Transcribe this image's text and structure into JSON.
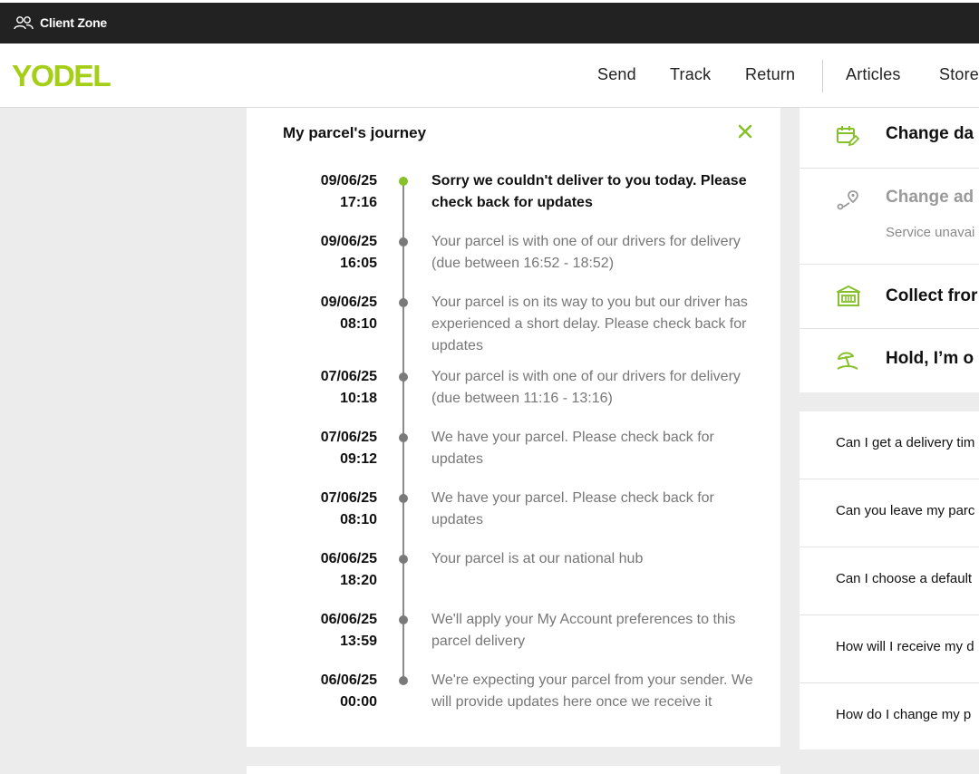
{
  "topbar": {
    "client_zone": "Client Zone"
  },
  "header": {
    "logo": "YODEL",
    "nav": [
      "Send",
      "Track",
      "Return",
      "Articles",
      "Store"
    ]
  },
  "journey": {
    "title": "My parcel's journey",
    "events": [
      {
        "date": "09/06/25",
        "time": "17:16",
        "message": "Sorry we couldn't deliver to you today. Please check back for updates",
        "active": true
      },
      {
        "date": "09/06/25",
        "time": "16:05",
        "message": "Your parcel is with one of our drivers for delivery (due between 16:52 - 18:52)"
      },
      {
        "date": "09/06/25",
        "time": "08:10",
        "message": "Your parcel is on its way to you but our driver has experienced a short delay. Please check back for updates"
      },
      {
        "date": "07/06/25",
        "time": "10:18",
        "message": "Your parcel is with one of our drivers for delivery (due between 11:16 - 13:16)"
      },
      {
        "date": "07/06/25",
        "time": "09:12",
        "message": "We have your parcel. Please check back for updates"
      },
      {
        "date": "07/06/25",
        "time": "08:10",
        "message": "We have your parcel. Please check back for updates"
      },
      {
        "date": "06/06/25",
        "time": "18:20",
        "message": "Your parcel is at our national hub"
      },
      {
        "date": "06/06/25",
        "time": "13:59",
        "message": "We'll apply your My Account preferences to this parcel delivery"
      },
      {
        "date": "06/06/25",
        "time": "00:00",
        "message": "We're expecting your parcel from your sender. We will provide updates here once we receive it"
      }
    ]
  },
  "actions": {
    "change_date": "Change da",
    "change_address": "Change ad",
    "change_address_sub": "Service unavai",
    "collect": "Collect fror",
    "hold": "Hold, I’m o"
  },
  "faq": [
    "Can I get a delivery tim",
    "Can you leave my parc",
    "Can I choose a default",
    "How will I receive my d",
    "How do I change my p"
  ],
  "colors": {
    "accent": "#a5cf17",
    "dark_bar": "#222222"
  }
}
